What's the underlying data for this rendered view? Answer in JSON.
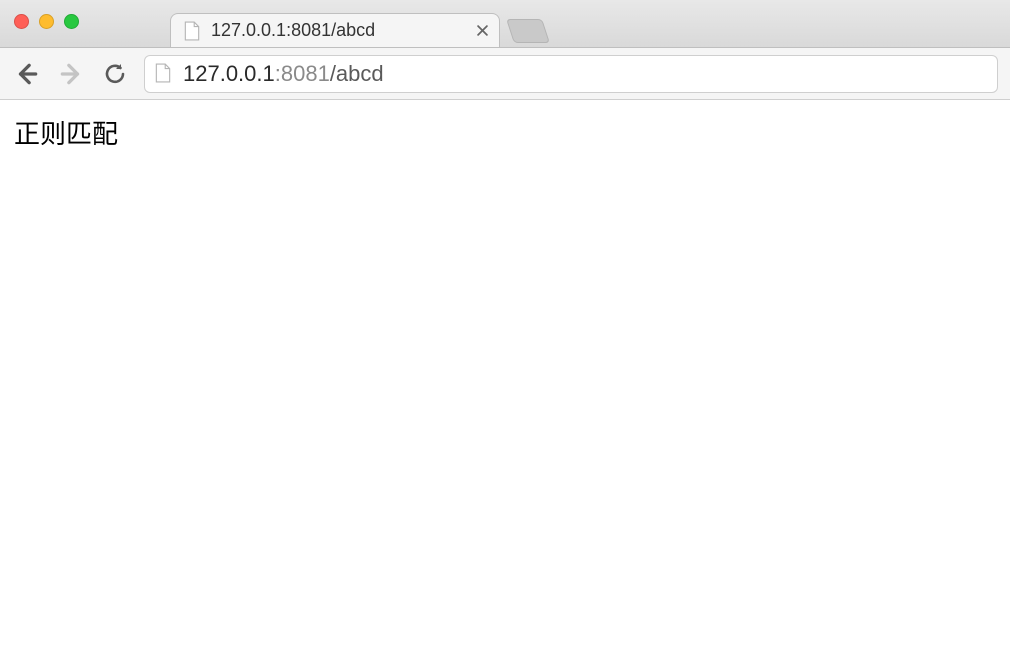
{
  "window": {
    "traffic_lights": [
      "close",
      "minimize",
      "zoom"
    ]
  },
  "tabs": [
    {
      "title": "127.0.0.1:8081/abcd",
      "favicon": "file-icon"
    }
  ],
  "address_bar": {
    "host": "127.0.0.1",
    "port": ":8081",
    "path": "/abcd"
  },
  "page": {
    "body_text": "正则匹配"
  }
}
